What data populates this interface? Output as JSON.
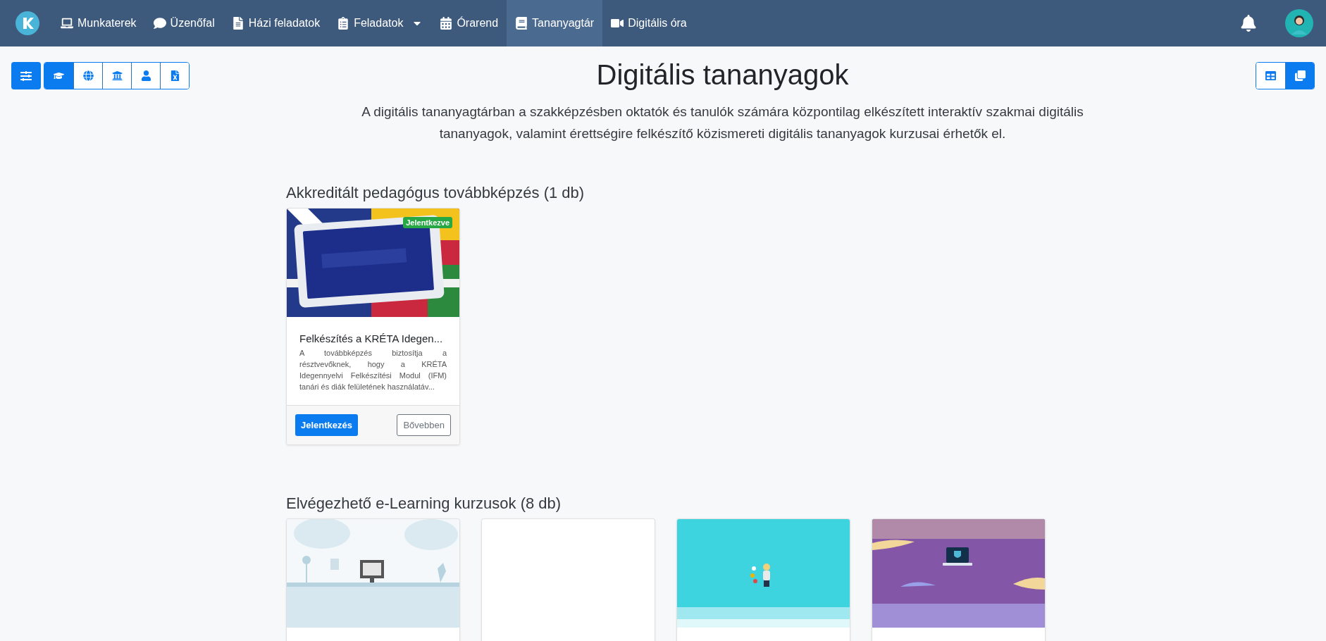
{
  "nav": {
    "items": [
      {
        "label": "Munkaterek",
        "selected": false
      },
      {
        "label": "Üzenőfal",
        "selected": false
      },
      {
        "label": "Házi feladatok",
        "selected": false
      },
      {
        "label": "Feladatok",
        "selected": false,
        "dropdown": true
      },
      {
        "label": "Órarend",
        "selected": false
      },
      {
        "label": "Tananyagtár",
        "selected": true
      },
      {
        "label": "Digitális óra",
        "selected": false
      }
    ]
  },
  "filter_buttons": [
    {
      "selected": true
    },
    {
      "selected": false
    },
    {
      "selected": false
    },
    {
      "selected": false
    },
    {
      "selected": false
    }
  ],
  "view_buttons": [
    {
      "selected": false
    },
    {
      "selected": true
    }
  ],
  "page": {
    "title": "Digitális tananyagok",
    "description": "A digitális tananyagtárban a szakképzésben oktatók és tanulók számára központilag elkészített interaktív szakmai digitális tananyagok, valamint érettségire felkészítő közismereti digitális tananyagok kurzusai érhetők el."
  },
  "sections": [
    {
      "title": "Akkreditált pedagógus továbbképzés (1 db)",
      "cards": [
        {
          "kind": "full",
          "badge": "Jelentkezve",
          "title": "Felkészítés a KRÉTA Idegen...",
          "description": "A továbbképzés biztosítja a résztvevőknek, hogy a KRÉTA Idegennyelvi Felkészítési Modul (IFM) tanári és diák felületének használatáv...",
          "primary_button": "Jelentkezés",
          "secondary_button": "Bővebben"
        }
      ]
    },
    {
      "title": "Elvégezhető e-Learning kurzusok (8 db)",
      "cards": [
        {
          "kind": "cut"
        },
        {
          "kind": "cut"
        },
        {
          "kind": "cut"
        },
        {
          "kind": "cut"
        }
      ]
    }
  ]
}
